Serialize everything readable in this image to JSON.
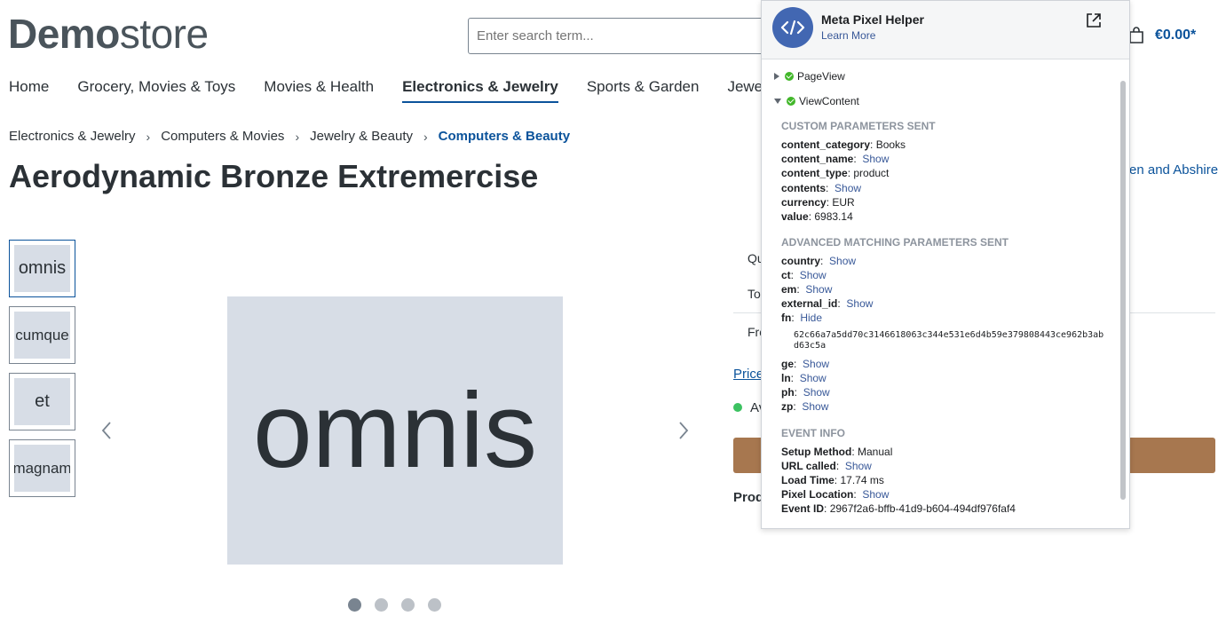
{
  "store": {
    "logo_bold": "Demo",
    "logo_light": "store",
    "search_placeholder": "Enter search term...",
    "cart_total": "€0.00*",
    "nav": [
      "Home",
      "Grocery, Movies & Toys",
      "Movies & Health",
      "Electronics & Jewelry",
      "Sports & Garden",
      "Jewelr"
    ],
    "breadcrumb": [
      "Electronics & Jewelry",
      "Computers & Movies",
      "Jewelry & Beauty",
      "Computers & Beauty"
    ],
    "product_title": "Aerodynamic Bronze Extremercise",
    "thumbnails": [
      "omnis",
      "cumque",
      "et",
      "magnam"
    ],
    "main_image_text": "omnis",
    "manufacturer_link": "en and Abshire",
    "side_qty": "Qu",
    "side_to": "To",
    "side_fro": "Fro",
    "price_link": "Price",
    "availability": "Av",
    "product_label": "Prod"
  },
  "pixel_helper": {
    "title": "Meta Pixel Helper",
    "learn_more": "Learn More",
    "events": [
      "PageView",
      "ViewContent"
    ],
    "custom_header": "CUSTOM PARAMETERS SENT",
    "custom_params": [
      {
        "key": "content_category",
        "value": "Books",
        "link": ""
      },
      {
        "key": "content_name",
        "value": "",
        "link": "Show"
      },
      {
        "key": "content_type",
        "value": "product",
        "link": ""
      },
      {
        "key": "contents",
        "value": "",
        "link": "Show"
      },
      {
        "key": "currency",
        "value": "EUR",
        "link": ""
      },
      {
        "key": "value",
        "value": "6983.14",
        "link": ""
      }
    ],
    "advanced_header": "ADVANCED MATCHING PARAMETERS SENT",
    "advanced_params": [
      {
        "key": "country",
        "link": "Show"
      },
      {
        "key": "ct",
        "link": "Show"
      },
      {
        "key": "em",
        "link": "Show"
      },
      {
        "key": "external_id",
        "link": "Show"
      },
      {
        "key": "fn",
        "link": "Hide"
      }
    ],
    "fn_hash": "62c66a7a5dd70c3146618063c344e531e6d4b59e379808443ce962b3abd63c5a",
    "advanced_params_2": [
      {
        "key": "ge",
        "link": "Show"
      },
      {
        "key": "ln",
        "link": "Show"
      },
      {
        "key": "ph",
        "link": "Show"
      },
      {
        "key": "zp",
        "link": "Show"
      }
    ],
    "event_header": "EVENT INFO",
    "event_info": [
      {
        "key": "Setup Method",
        "value": "Manual",
        "link": ""
      },
      {
        "key": "URL called",
        "value": "",
        "link": "Show"
      },
      {
        "key": "Load Time",
        "value": "17.74 ms",
        "link": ""
      },
      {
        "key": "Pixel Location",
        "value": "",
        "link": "Show"
      },
      {
        "key": "Event ID",
        "value": "2967f2a6-bffb-41d9-b604-494df976faf4",
        "link": ""
      }
    ]
  }
}
